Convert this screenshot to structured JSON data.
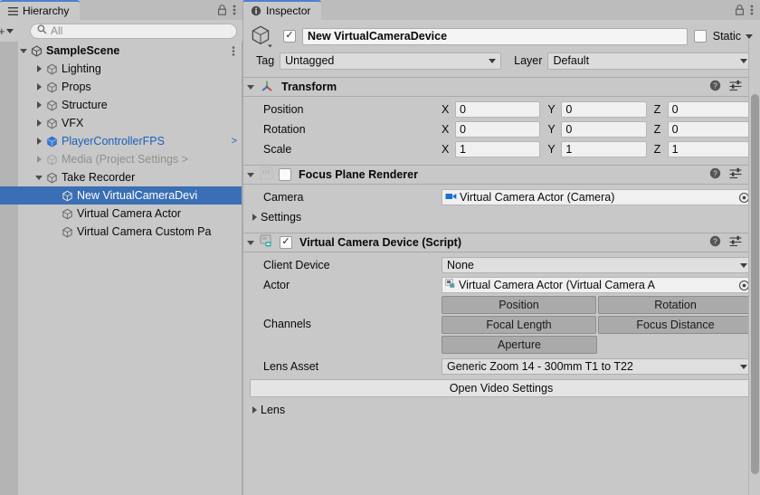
{
  "hierarchy": {
    "tab_label": "Hierarchy",
    "tab_icon": "hierarchy-icon",
    "lock_icon": "lock-icon",
    "menu_icon": "kebab-menu-icon",
    "create_label": "+",
    "search": {
      "placeholder": "All",
      "value": "",
      "icon": "search-icon"
    },
    "rows": [
      {
        "label": "SampleScene",
        "indent": 1,
        "twisty": "down",
        "icon": "scene-icon",
        "style": "scene",
        "kebab": true
      },
      {
        "label": "Lighting",
        "indent": 2,
        "twisty": "right",
        "icon": "gameobject-icon",
        "style": ""
      },
      {
        "label": "Props",
        "indent": 2,
        "twisty": "right",
        "icon": "gameobject-icon",
        "style": ""
      },
      {
        "label": "Structure",
        "indent": 2,
        "twisty": "right",
        "icon": "gameobject-icon",
        "style": ""
      },
      {
        "label": "VFX",
        "indent": 2,
        "twisty": "right",
        "icon": "gameobject-icon",
        "style": ""
      },
      {
        "label": "PlayerControllerFPS",
        "indent": 2,
        "twisty": "right",
        "icon": "prefab-icon",
        "style": "blue-text",
        "chevron": ">"
      },
      {
        "label": "Media (Project Settings >",
        "indent": 2,
        "twisty": "right",
        "icon": "gameobject-icon",
        "style": "dim"
      },
      {
        "label": "Take Recorder",
        "indent": 2,
        "twisty": "down",
        "icon": "gameobject-icon",
        "style": ""
      },
      {
        "label": "New VirtualCameraDevi",
        "indent": 3,
        "twisty": "none",
        "icon": "gameobject-icon",
        "style": "sel"
      },
      {
        "label": "Virtual Camera Actor",
        "indent": 3,
        "twisty": "none",
        "icon": "gameobject-icon",
        "style": ""
      },
      {
        "label": "Virtual Camera Custom Pa",
        "indent": 3,
        "twisty": "none",
        "icon": "gameobject-icon",
        "style": ""
      }
    ]
  },
  "inspector": {
    "tab_label": "Inspector",
    "tab_icon": "info-icon",
    "lock_icon": "lock-icon",
    "menu_icon": "kebab-menu-icon",
    "header": {
      "object_icon": "gameobject-cube-icon",
      "enabled": true,
      "name": "New VirtualCameraDevice",
      "static_label": "Static",
      "static_checked": false,
      "tag_label": "Tag",
      "tag_value": "Untagged",
      "layer_label": "Layer",
      "layer_value": "Default"
    },
    "components": [
      {
        "title": "Transform",
        "icon": "transform-gizmo-icon",
        "expanded": true,
        "has_checkbox": false,
        "help_icon": "help-icon",
        "preset_icon": "preset-icon",
        "menu_icon": "kebab-menu-icon",
        "rows": [
          {
            "kind": "vector3",
            "label": "Position",
            "axes": [
              "X",
              "Y",
              "Z"
            ],
            "values": [
              "0",
              "0",
              "0"
            ]
          },
          {
            "kind": "vector3",
            "label": "Rotation",
            "axes": [
              "X",
              "Y",
              "Z"
            ],
            "values": [
              "0",
              "0",
              "0"
            ]
          },
          {
            "kind": "vector3",
            "label": "Scale",
            "axes": [
              "X",
              "Y",
              "Z"
            ],
            "values": [
              "1",
              "1",
              "1"
            ]
          }
        ]
      },
      {
        "title": "Focus Plane Renderer",
        "icon": "script-icon",
        "expanded": true,
        "has_checkbox": true,
        "checked": false,
        "help_icon": "help-icon",
        "preset_icon": "preset-icon",
        "menu_icon": "kebab-menu-icon",
        "rows": [
          {
            "kind": "object",
            "label": "Camera",
            "value": "Virtual Camera Actor (Camera)",
            "value_icon": "camera-icon",
            "picker_icon": "object-picker-icon"
          },
          {
            "kind": "foldout",
            "label": "Settings",
            "expanded": false
          }
        ]
      },
      {
        "title": "Virtual Camera Device (Script)",
        "icon": "script-icon",
        "expanded": true,
        "has_checkbox": true,
        "checked": true,
        "help_icon": "help-icon",
        "preset_icon": "preset-icon",
        "menu_icon": "kebab-menu-icon",
        "rows": [
          {
            "kind": "dropdown",
            "label": "Client Device",
            "value": "None"
          },
          {
            "kind": "object",
            "label": "Actor",
            "value": "Virtual Camera Actor (Virtual Camera A",
            "value_icon": "script-asset-icon",
            "picker_icon": "object-picker-icon"
          },
          {
            "kind": "channels",
            "label": "Channels",
            "buttons": [
              "Position",
              "Rotation",
              "Focal Length",
              "Focus Distance",
              "Aperture"
            ]
          },
          {
            "kind": "dropdown",
            "label": "Lens Asset",
            "value": "Generic Zoom 14 - 300mm T1 to T22"
          },
          {
            "kind": "button",
            "label": "Open Video Settings"
          },
          {
            "kind": "foldout",
            "label": "Lens",
            "expanded": false
          }
        ]
      }
    ]
  },
  "colors": {
    "panel_bg": "#c8c8c8",
    "tabbar_bg": "#bcbcbc",
    "selection_blue": "#3a6fb5",
    "accent_tab": "#4b7fd4",
    "prefab_blue": "#1d5fbd",
    "field_bg": "#f0f0f0",
    "dropdown_bg": "#dfdfdf",
    "channel_active": "#aaaaaa"
  }
}
